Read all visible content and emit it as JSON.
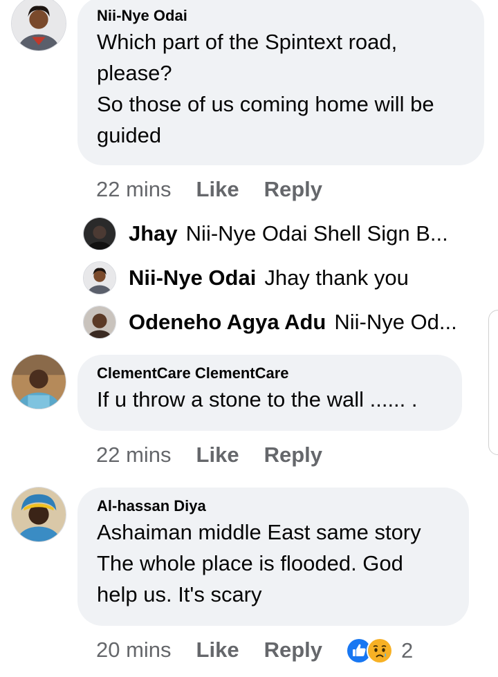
{
  "comments": [
    {
      "author": "Nii-Nye Odai",
      "lines": [
        "Which part of the Spintext road,",
        "please?",
        "So those of us coming home will be",
        "guided"
      ],
      "time": "22 mins",
      "like": "Like",
      "reply": "Reply",
      "replies": [
        {
          "name": "Jhay",
          "text": "Nii-Nye Odai Shell Sign B..."
        },
        {
          "name": "Nii-Nye Odai",
          "text": "Jhay thank you"
        },
        {
          "name": "Odeneho Agya Adu",
          "text": "Nii-Nye Od..."
        }
      ]
    },
    {
      "author": "ClementCare ClementCare",
      "lines": [
        "If u throw a stone to the wall ...... ."
      ],
      "time": "22 mins",
      "like": "Like",
      "reply": "Reply"
    },
    {
      "author": "Al-hassan Diya",
      "lines": [
        "Ashaiman middle East same story",
        "The whole place is flooded. God",
        "help us. It's scary"
      ],
      "time": "20 mins",
      "like": "Like",
      "reply": "Reply",
      "reactions": {
        "icons": [
          "like-reaction-icon",
          "sad-reaction-icon"
        ],
        "count": "2"
      }
    }
  ],
  "colors": {
    "bubble": "#f0f2f5",
    "meta": "#65676b",
    "like_blue": "#1877f2",
    "sad_yellow": "#f7b125"
  }
}
